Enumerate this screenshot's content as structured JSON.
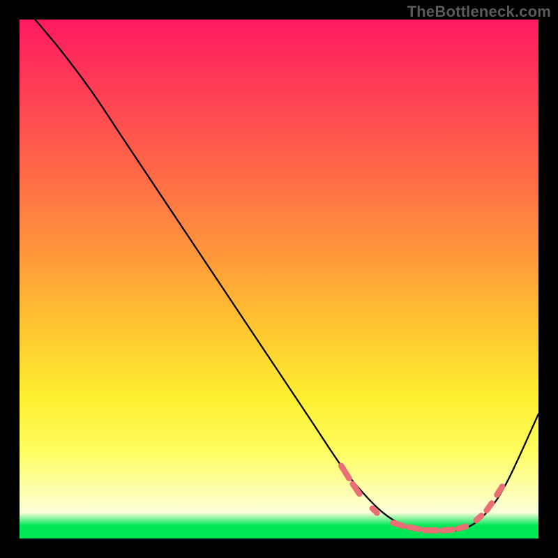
{
  "watermark": "TheBottleneck.com",
  "chart_data": {
    "type": "line",
    "title": "",
    "xlabel": "",
    "ylabel": "",
    "xlim": [
      0,
      100
    ],
    "ylim": [
      0,
      100
    ],
    "series": [
      {
        "name": "bottleneck-curve",
        "x": [
          3,
          8,
          14,
          20,
          26,
          32,
          38,
          44,
          50,
          56,
          62,
          66,
          70,
          74,
          78,
          82,
          86,
          90,
          94,
          100
        ],
        "y": [
          100,
          94,
          86,
          77,
          68,
          59,
          50,
          41,
          32,
          23,
          14,
          9,
          5,
          2.5,
          1.5,
          1.5,
          2,
          5,
          11,
          24
        ]
      }
    ],
    "highlight_dashes": {
      "name": "optimal-range-markers",
      "segments": [
        {
          "x0": 62.0,
          "y0": 14.0,
          "x1": 63.5,
          "y1": 11.6
        },
        {
          "x0": 64.2,
          "y0": 10.5,
          "x1": 65.5,
          "y1": 8.6
        },
        {
          "x0": 68.0,
          "y0": 5.8,
          "x1": 68.9,
          "y1": 4.9
        },
        {
          "x0": 72.0,
          "y0": 3.0,
          "x1": 74.0,
          "y1": 2.4
        },
        {
          "x0": 75.0,
          "y0": 2.2,
          "x1": 77.0,
          "y1": 1.8
        },
        {
          "x0": 78.0,
          "y0": 1.6,
          "x1": 80.5,
          "y1": 1.55
        },
        {
          "x0": 81.5,
          "y0": 1.55,
          "x1": 83.5,
          "y1": 1.7
        },
        {
          "x0": 84.5,
          "y0": 1.9,
          "x1": 86.0,
          "y1": 2.3
        },
        {
          "x0": 88.0,
          "y0": 3.5,
          "x1": 89.0,
          "y1": 4.4
        },
        {
          "x0": 90.0,
          "y0": 5.4,
          "x1": 91.0,
          "y1": 6.8
        },
        {
          "x0": 92.0,
          "y0": 8.4,
          "x1": 93.0,
          "y1": 10.0
        }
      ]
    },
    "gradient_stops": [
      {
        "pos": 0.0,
        "color": "#ff1a61"
      },
      {
        "pos": 0.3,
        "color": "#ff6a47"
      },
      {
        "pos": 0.6,
        "color": "#ffc830"
      },
      {
        "pos": 0.83,
        "color": "#fdfd5e"
      },
      {
        "pos": 0.95,
        "color": "#fcffda"
      },
      {
        "pos": 0.975,
        "color": "#00e756"
      },
      {
        "pos": 1.0,
        "color": "#00e756"
      }
    ]
  }
}
